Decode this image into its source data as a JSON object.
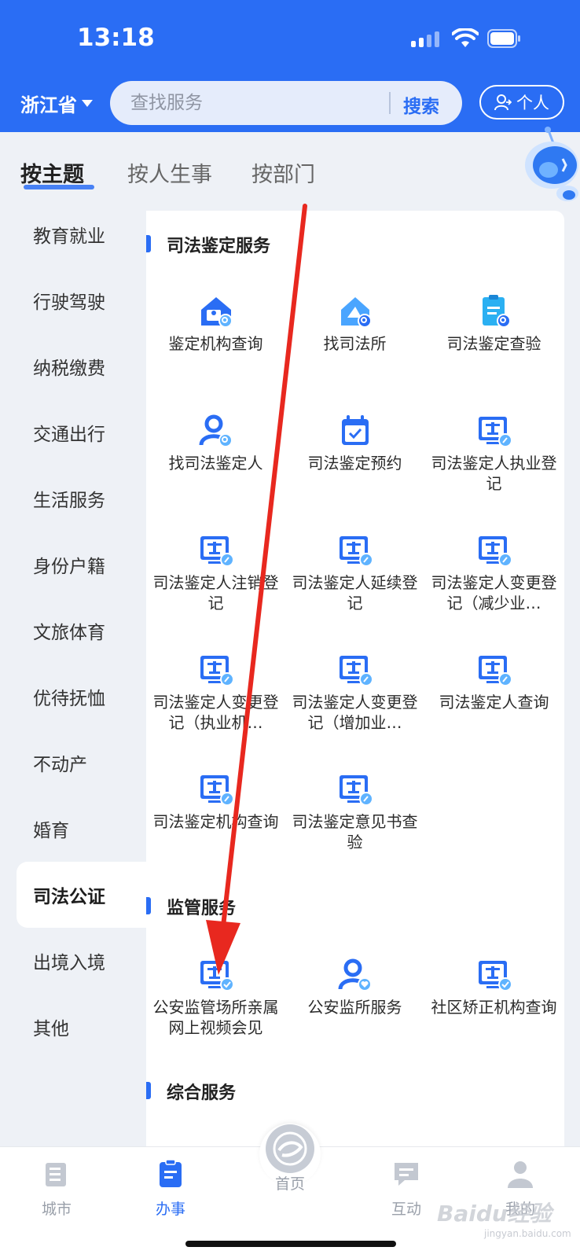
{
  "status_bar": {
    "time": "13:18"
  },
  "header": {
    "province": "浙江省",
    "search_placeholder": "查找服务",
    "search_button": "搜索",
    "personal_button": "个人"
  },
  "top_tabs": [
    "按主题",
    "按人生事",
    "按部门"
  ],
  "sidebar": {
    "items": [
      "教育就业",
      "行驶驾驶",
      "纳税缴费",
      "交通出行",
      "生活服务",
      "身份户籍",
      "文旅体育",
      "优待抚恤",
      "不动产",
      "婚育",
      "司法公证",
      "出境入境",
      "其他"
    ],
    "active": "司法公证"
  },
  "sections": [
    {
      "title": "司法鉴定服务",
      "tiles": [
        {
          "label": "鉴定机构查询",
          "icon": "institution-search-icon"
        },
        {
          "label": "找司法所",
          "icon": "house-search-icon"
        },
        {
          "label": "司法鉴定查验",
          "icon": "clipboard-search-icon"
        },
        {
          "label": "找司法鉴定人",
          "icon": "person-search-icon"
        },
        {
          "label": "司法鉴定预约",
          "icon": "calendar-check-icon"
        },
        {
          "label": "司法鉴定人执业登记",
          "icon": "scales-edit-icon"
        },
        {
          "label": "司法鉴定人注销登记",
          "icon": "scales-edit-icon"
        },
        {
          "label": "司法鉴定人延续登记",
          "icon": "scales-edit-icon"
        },
        {
          "label": "司法鉴定人变更登记（减少业…",
          "icon": "scales-edit-icon"
        },
        {
          "label": "司法鉴定人变更登记（执业机…",
          "icon": "scales-edit-icon"
        },
        {
          "label": "司法鉴定人变更登记（增加业…",
          "icon": "scales-edit-icon"
        },
        {
          "label": "司法鉴定人查询",
          "icon": "scales-edit-icon"
        },
        {
          "label": "司法鉴定机构查询",
          "icon": "scales-edit-icon"
        },
        {
          "label": "司法鉴定意见书查验",
          "icon": "scales-edit-icon"
        }
      ]
    },
    {
      "title": "监管服务",
      "tiles": [
        {
          "label": "公安监管场所亲属网上视频会见",
          "icon": "scales-check-icon"
        },
        {
          "label": "公安监所服务",
          "icon": "person-heart-icon"
        },
        {
          "label": "社区矫正机构查询",
          "icon": "scales-check-icon"
        }
      ]
    },
    {
      "title": "综合服务",
      "tiles": []
    }
  ],
  "bottom_nav": [
    {
      "label": "城市",
      "icon": "city-icon"
    },
    {
      "label": "办事",
      "icon": "affairs-icon",
      "active": true
    },
    {
      "label": "首页",
      "icon": "home-logo-icon"
    },
    {
      "label": "互动",
      "icon": "chat-icon"
    },
    {
      "label": "我的",
      "icon": "user-icon"
    }
  ],
  "watermark": {
    "text": "Baidu经验",
    "url": "jingyan.baidu.com"
  },
  "colors": {
    "primary": "#2a6df4",
    "annotation": "#e8281f"
  }
}
